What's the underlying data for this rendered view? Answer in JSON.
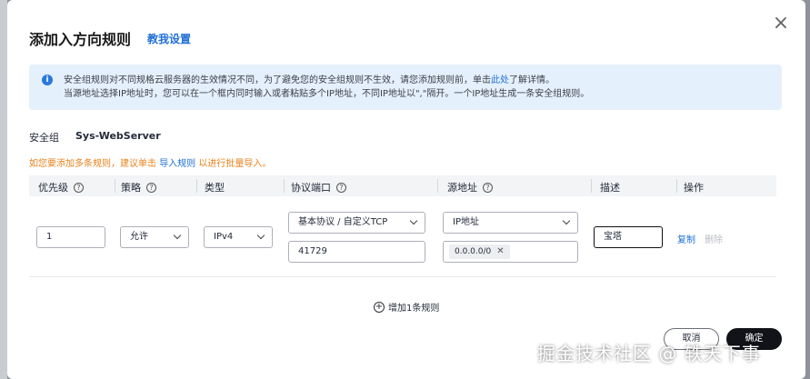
{
  "dialog": {
    "title": "添加入方向规则",
    "help_link": "教我设置",
    "close_icon": "close-icon"
  },
  "notice": {
    "line1_before": "安全组规则对不同规格云服务器的生效情况不同，为了避免您的安全组规则不生效，请您添加规则前，单击",
    "line1_link": "此处",
    "line1_after": "了解详情。",
    "line2": "当源地址选择IP地址时，您可以在一个框内同时输入或者粘贴多个IP地址，不同IP地址以\",\"隔开。一个IP地址生成一条安全组规则。"
  },
  "security_group": {
    "label": "安全组",
    "value": "Sys-WebServer"
  },
  "bulk_tip": {
    "before": "如您要添加多条规则，建议单击 ",
    "link": "导入规则",
    "after": " 以进行批量导入。"
  },
  "table": {
    "headers": {
      "priority": "优先级",
      "policy": "策略",
      "type": "类型",
      "protocol_port": "协议端口",
      "source": "源地址",
      "description": "描述",
      "action": "操作"
    },
    "row": {
      "priority": "1",
      "policy": "允许",
      "type": "IPv4",
      "protocol": "基本协议 / 自定义TCP",
      "port": "41729",
      "source_type": "IP地址",
      "source_ip": "0.0.0.0/0",
      "description": "宝塔",
      "copy": "复制",
      "delete": "删除"
    }
  },
  "add_rule": "增加1条规则",
  "buttons": {
    "cancel": "取消",
    "ok": "确定"
  },
  "watermark": "掘金技术社区 @ 轶天下事",
  "colors": {
    "accent": "#1f6fd6",
    "notice_bg": "#e5f0fd",
    "warning": "#e8821c",
    "primary_button": "#111318"
  }
}
